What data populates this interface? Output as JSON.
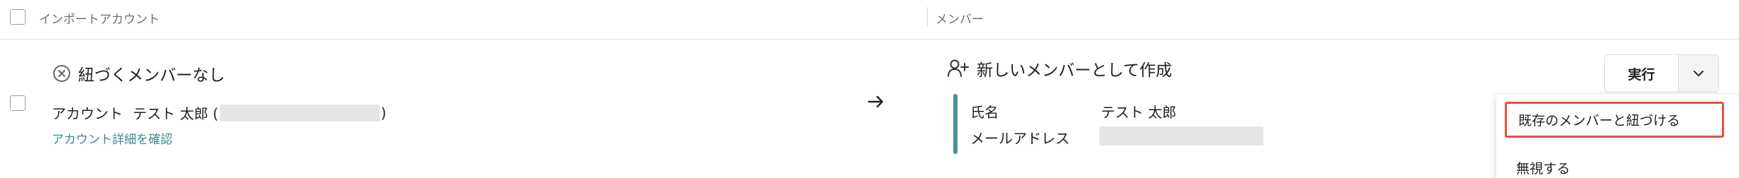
{
  "header": {
    "imported_account_label": "インポートアカウント",
    "member_label": "メンバー"
  },
  "row": {
    "status_text": "紐づくメンバーなし",
    "account_prefix": "アカウント",
    "account_name": "テスト 太郎 (",
    "account_suffix": ")",
    "detail_link": "アカウント詳細を確認",
    "create_label": "新しいメンバーとして作成",
    "fields": {
      "name_label": "氏名",
      "name_value": "テスト 太郎",
      "email_label": "メールアドレス"
    },
    "exec_label": "実行"
  },
  "menu": {
    "link_existing": "既存のメンバーと紐づける",
    "ignore": "無視する"
  },
  "colors": {
    "accent": "#4a8f93",
    "link": "#3e8a8f",
    "highlight": "#e2533a"
  }
}
